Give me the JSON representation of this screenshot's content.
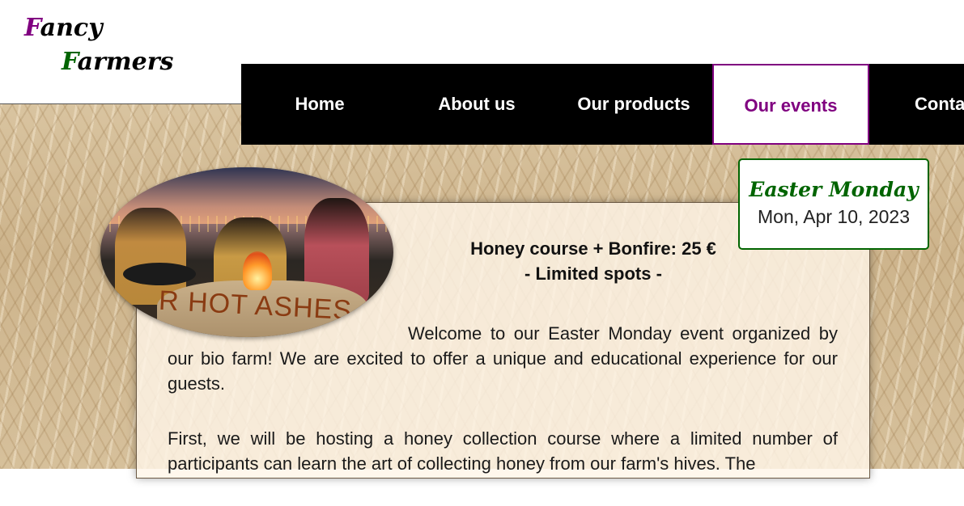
{
  "logo": {
    "line1_cap": "F",
    "line1_rest": "ancy",
    "line2_cap": "F",
    "line2_rest": "armers"
  },
  "nav": {
    "items": [
      {
        "label": "Home"
      },
      {
        "label": "About us"
      },
      {
        "label": "Our products"
      },
      {
        "label": "Our events",
        "active": true
      },
      {
        "label": "Contact"
      }
    ]
  },
  "event": {
    "name": "Easter Monday",
    "date": "Mon, Apr 10, 2023"
  },
  "headline": {
    "line1": "Honey course + Bonfire: 25 €",
    "line2": "- Limited spots -"
  },
  "photo": {
    "sign_text": "R HOT ASHES"
  },
  "content": {
    "paragraph1": "Welcome to our Easter Monday event organized by our bio farm! We are excited to offer a unique and educational experience for our guests.",
    "paragraph2": "First, we will be hosting a honey collection course where a limited number of participants can learn the art of collecting honey from our farm's hives. The"
  },
  "colors": {
    "accent_purple": "#800080",
    "accent_green": "#006400",
    "nav_bg": "#000000"
  }
}
